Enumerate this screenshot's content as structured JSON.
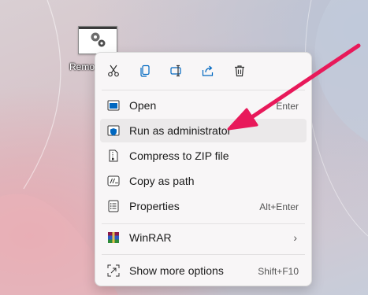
{
  "desktop": {
    "icon_label": "Remo"
  },
  "toolbar": {
    "icons": [
      "cut-icon",
      "copy-icon",
      "rename-icon",
      "share-icon",
      "delete-icon"
    ]
  },
  "menu": {
    "items": [
      {
        "label": "Open",
        "shortcut": "Enter"
      },
      {
        "label": "Run as administrator",
        "shortcut": ""
      },
      {
        "label": "Compress to ZIP file",
        "shortcut": ""
      },
      {
        "label": "Copy as path",
        "shortcut": ""
      },
      {
        "label": "Properties",
        "shortcut": "Alt+Enter"
      },
      {
        "label": "WinRAR",
        "shortcut": ""
      },
      {
        "label": "Show more options",
        "shortcut": "Shift+F10"
      }
    ]
  },
  "colors": {
    "accent": "#0067c0",
    "arrow": "#e8195a",
    "menu_bg": "#f8f6f7"
  }
}
